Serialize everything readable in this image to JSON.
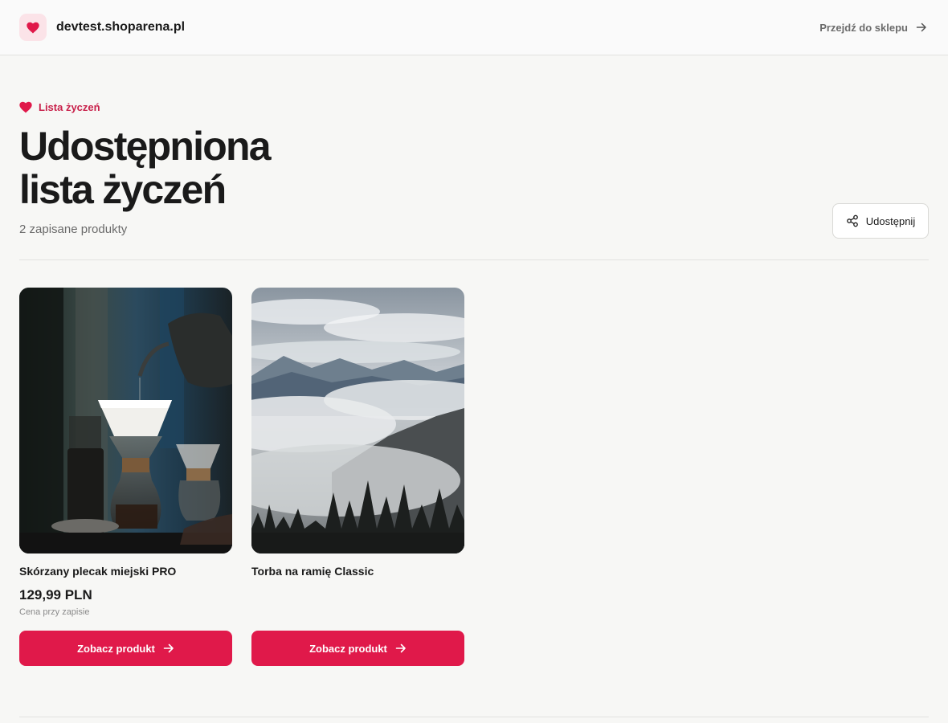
{
  "header": {
    "store_name": "devtest.shoparena.pl",
    "store_link_label": "Przejdź do sklepu"
  },
  "hero": {
    "eyebrow": "Lista życzeń",
    "title_line1": "Udostępniona",
    "title_line2": "lista życzeń",
    "count_text": "2 zapisane produkty",
    "share_label": "Udostępnij"
  },
  "products": [
    {
      "name": "Skórzany plecak miejski PRO",
      "price": "129,99 PLN",
      "price_note": "Cena przy zapisie",
      "button_label": "Zobacz produkt",
      "image": "coffee-brewing-photo"
    },
    {
      "name": "Torba na ramię Classic",
      "button_label": "Zobacz produkt",
      "image": "misty-mountains-photo"
    }
  ],
  "colors": {
    "accent": "#e0194a",
    "accent_soft": "#fbe3e8",
    "eyebrow": "#c8204a",
    "background": "#f7f7f5"
  },
  "icons": {
    "logo": "heart-icon",
    "store_link": "arrow-right-icon",
    "eyebrow": "heart-icon",
    "share": "share-icon",
    "card_button": "arrow-right-icon"
  }
}
